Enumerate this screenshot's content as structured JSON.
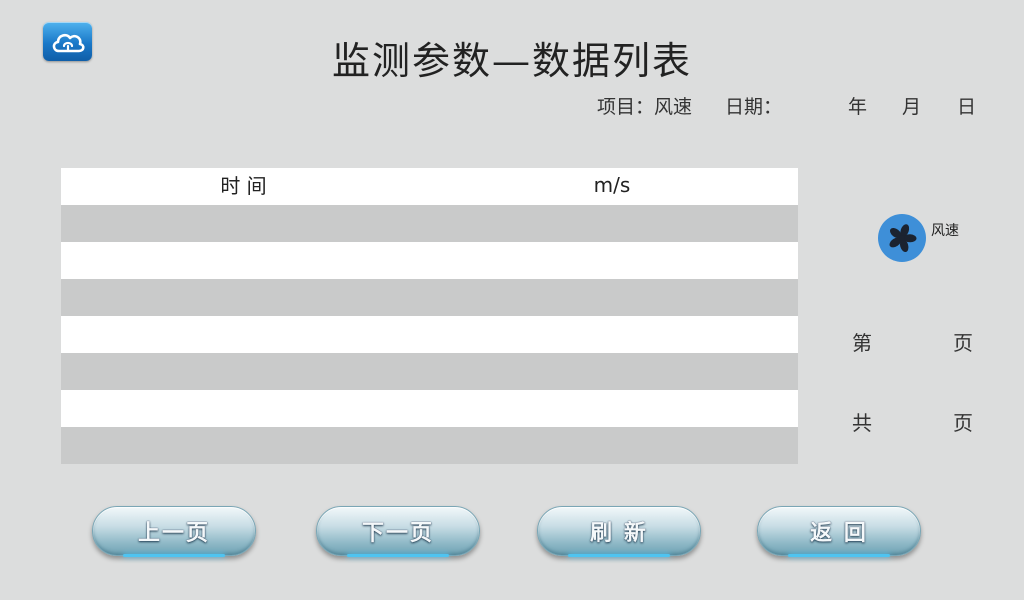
{
  "header": {
    "title": "监测参数—数据列表",
    "project_label": "项目：风速",
    "date_label": "日期：",
    "year_label": "年",
    "month_label": "月",
    "day_label": "日"
  },
  "table": {
    "columns": [
      "时 间",
      "m/s"
    ],
    "rows": [
      [
        "",
        ""
      ],
      [
        "",
        ""
      ],
      [
        "",
        ""
      ],
      [
        "",
        ""
      ],
      [
        "",
        ""
      ],
      [
        "",
        ""
      ],
      [
        "",
        ""
      ]
    ]
  },
  "sidebar": {
    "sensor_label": "风速",
    "page_prefix": "第",
    "page_suffix": "页",
    "total_prefix": "共",
    "total_suffix": "页"
  },
  "buttons": {
    "prev": "上一页",
    "next": "下一页",
    "refresh": "刷 新",
    "back": "返 回"
  },
  "colors": {
    "background": "#dcdddd",
    "row_alt": "#c9caca",
    "fan_icon": "#3e8fd8"
  }
}
